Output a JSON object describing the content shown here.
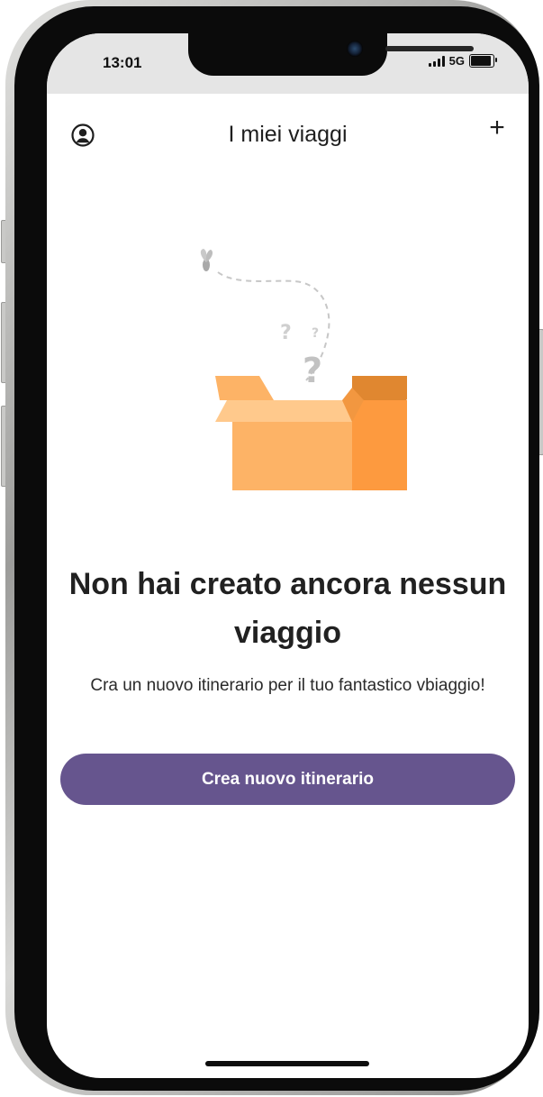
{
  "status_bar": {
    "time": "13:01",
    "network": "5G",
    "battery_level_percent": 90
  },
  "header": {
    "title": "I miei viaggi",
    "profile_icon": "user-circle-icon",
    "add_label": "+"
  },
  "empty_state": {
    "illustration": "empty-box-illustration",
    "title": "Non hai creato ancora nessun viaggio",
    "subtitle": "Cra un nuovo itinerario per il tuo fantastico vbiaggio!",
    "cta_label": "Crea nuovo itinerario"
  },
  "colors": {
    "accent": "#66558e",
    "status_bar_bg": "#e5e5e5",
    "box_light": "#fdb366",
    "box_dark": "#fd9a3f"
  }
}
